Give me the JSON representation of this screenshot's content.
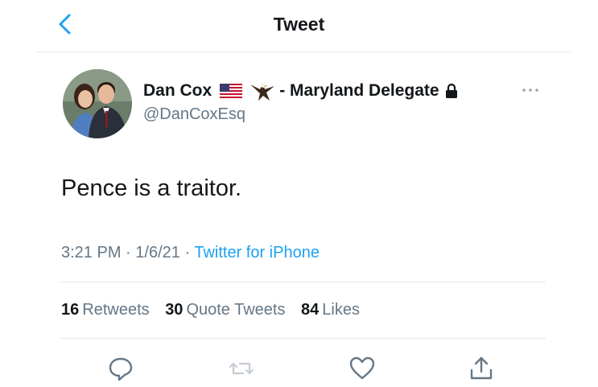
{
  "header": {
    "title": "Tweet"
  },
  "author": {
    "name": "Dan Cox",
    "bio_suffix": "- Maryland Delegate",
    "handle": "@DanCoxEsq"
  },
  "tweet": {
    "text": "Pence is a traitor.",
    "time": "3:21 PM",
    "date": "1/6/21",
    "separator": "·",
    "source": "Twitter for iPhone"
  },
  "stats": {
    "retweets_count": "16",
    "retweets_label": "Retweets",
    "quotes_count": "30",
    "quotes_label": "Quote Tweets",
    "likes_count": "84",
    "likes_label": "Likes"
  },
  "icons": {
    "back": "chevron-left-icon",
    "flag": "us-flag-icon",
    "eagle": "eagle-icon",
    "lock": "lock-icon",
    "more": "more-icon",
    "reply": "reply-icon",
    "retweet": "retweet-icon",
    "like": "heart-icon",
    "share": "share-icon"
  },
  "colors": {
    "accent": "#1da1f2",
    "text": "#14171a",
    "secondary": "#657786",
    "divider": "#e1e8ed"
  }
}
